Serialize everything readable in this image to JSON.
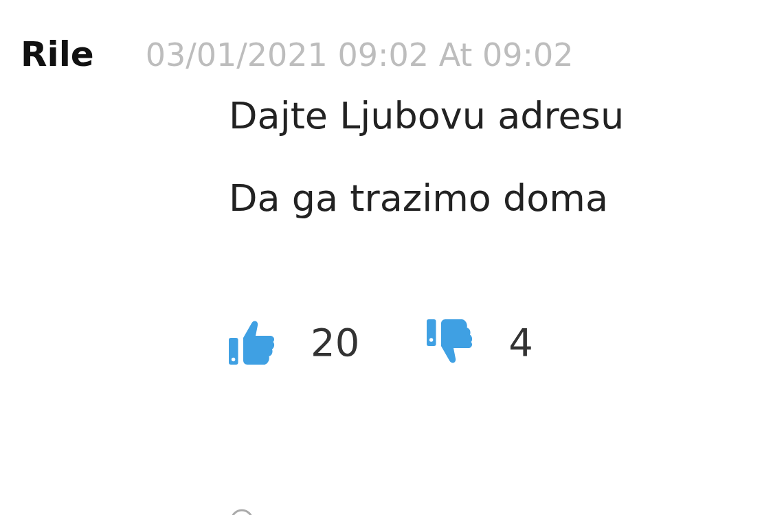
{
  "comment": {
    "author": "Rile",
    "timestamp": "03/01/2021 09:02 At 09:02",
    "lines": [
      "Dajte Ljubovu adresu",
      "Da ga trazimo doma"
    ],
    "likes": "20",
    "dislikes": "4"
  }
}
